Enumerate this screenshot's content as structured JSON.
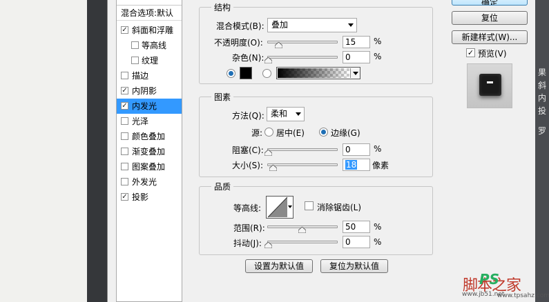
{
  "style_list": {
    "blending_options": "混合选项:默认",
    "items": [
      {
        "label": "斜面和浮雕",
        "checked": true,
        "indent": false,
        "selected": false
      },
      {
        "label": "等高线",
        "checked": false,
        "indent": true,
        "selected": false
      },
      {
        "label": "纹理",
        "checked": false,
        "indent": true,
        "selected": false
      },
      {
        "label": "描边",
        "checked": false,
        "indent": false,
        "selected": false
      },
      {
        "label": "内阴影",
        "checked": true,
        "indent": false,
        "selected": false
      },
      {
        "label": "内发光",
        "checked": true,
        "indent": false,
        "selected": true
      },
      {
        "label": "光泽",
        "checked": false,
        "indent": false,
        "selected": false
      },
      {
        "label": "颜色叠加",
        "checked": false,
        "indent": false,
        "selected": false
      },
      {
        "label": "渐变叠加",
        "checked": false,
        "indent": false,
        "selected": false
      },
      {
        "label": "图案叠加",
        "checked": false,
        "indent": false,
        "selected": false
      },
      {
        "label": "外发光",
        "checked": false,
        "indent": false,
        "selected": false
      },
      {
        "label": "投影",
        "checked": true,
        "indent": false,
        "selected": false
      }
    ]
  },
  "structure": {
    "title": "结构",
    "blend_mode_label": "混合模式(B):",
    "blend_mode_value": "叠加",
    "opacity_label": "不透明度(O):",
    "opacity_value": "15",
    "opacity_level": 0.15,
    "noise_label": "杂色(N):",
    "noise_value": "0",
    "noise_level": 0.0,
    "percent": "%"
  },
  "elements": {
    "title": "图素",
    "method_label": "方法(Q):",
    "method_value": "柔和",
    "source_label": "源:",
    "source_center": "居中(E)",
    "source_edge": "边缘(G)",
    "choke_label": "阻塞(C):",
    "choke_value": "0",
    "choke_level": 0.0,
    "size_label": "大小(S):",
    "size_value": "18",
    "size_level": 0.07,
    "size_unit": "像素",
    "percent": "%"
  },
  "quality": {
    "title": "品质",
    "contour_label": "等高线:",
    "anti_alias_label": "消除锯齿(L)",
    "range_label": "范围(R):",
    "range_value": "50",
    "range_level": 0.5,
    "jitter_label": "抖动(J):",
    "jitter_value": "0",
    "jitter_level": 0.0,
    "percent": "%"
  },
  "buttons": {
    "make_default": "设置为默认值",
    "reset_default": "复位为默认值",
    "ok_partial": "确定",
    "reset": "复位",
    "new_style": "新建样式(W)...",
    "preview": "预览(V)"
  },
  "right_strip_chars": [
    "果",
    "斜",
    "内",
    "投",
    "罗"
  ],
  "watermark": {
    "main": "脚本之家",
    "sub": "www.jb51.net",
    "ps": "PS",
    "site": "www.tpsahz.com"
  },
  "colors": {
    "selected": "#3399ff",
    "accent_radio": "#1f6fb5"
  }
}
